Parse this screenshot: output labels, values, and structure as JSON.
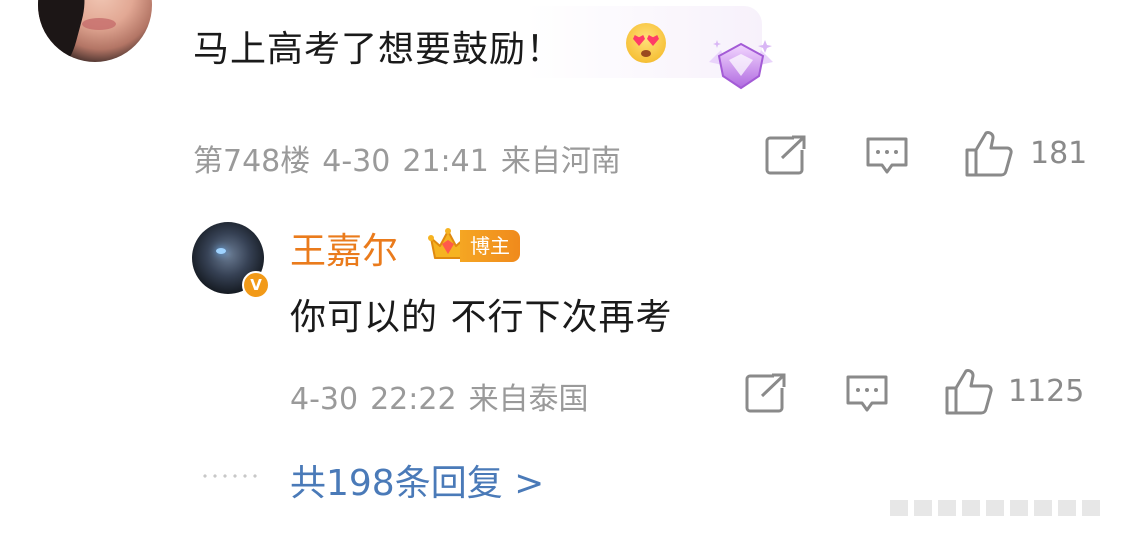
{
  "comment": {
    "text": "马上高考了想要鼓励！",
    "floor": "第748楼",
    "date": "4-30",
    "time": "21:41",
    "location": "来自河南",
    "likes": "181",
    "emoji_icon": "heart-eyes-emoji",
    "badge_icon": "diamond-fan-badge"
  },
  "reply": {
    "author": "王嘉尔",
    "author_color": "#ea7b1c",
    "tag": "博主",
    "verified_mark": "V",
    "text": "你可以的 不行下次再考",
    "date": "4-30",
    "time": "22:22",
    "location": "来自泰国",
    "likes": "1125"
  },
  "more_replies": "共198条回复 >",
  "icons": {
    "share": "share-icon",
    "comment": "comment-icon",
    "like": "thumbs-up-icon"
  }
}
